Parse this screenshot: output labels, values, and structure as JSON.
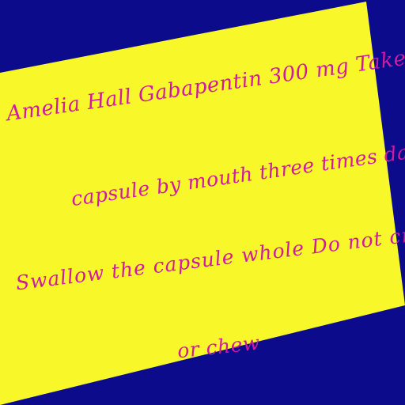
{
  "background_color": "#0b0b8c",
  "note_color": "#f7f72a",
  "text_color": "#d01aa0",
  "lines": [
    "Amelia Hall Gabapentin 300 mg Take",
    "capsule by mouth three times daily",
    "Swallow the capsule whole Do not crush",
    "or chew"
  ]
}
